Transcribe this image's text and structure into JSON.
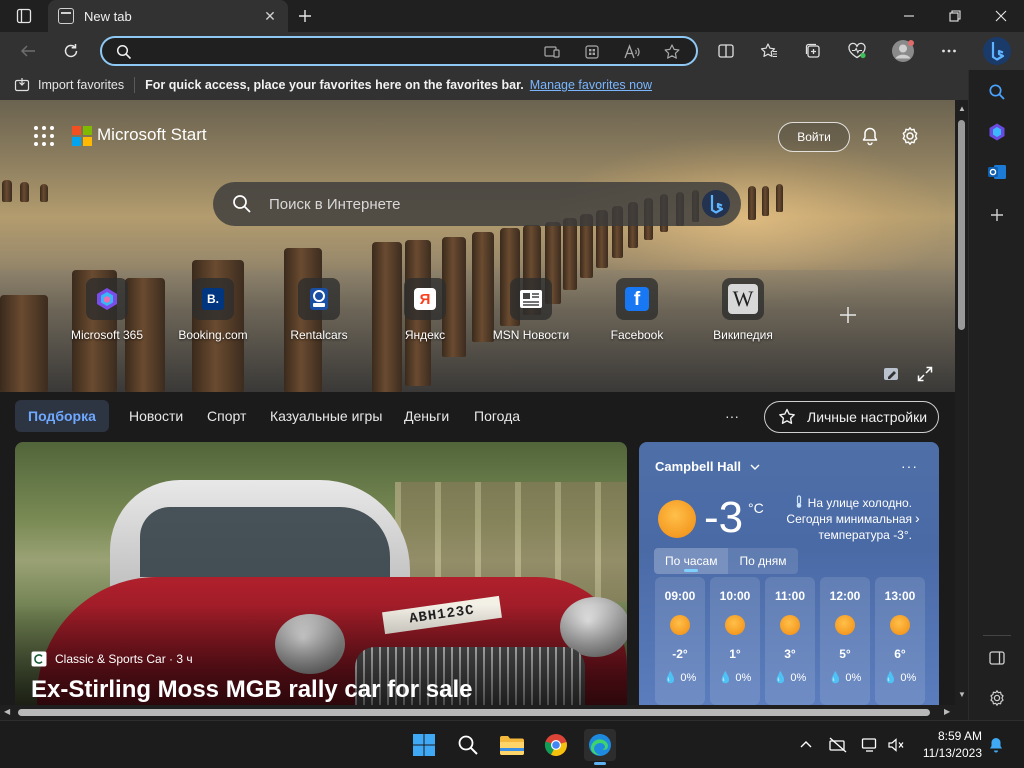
{
  "tab": {
    "title": "New tab"
  },
  "address": {
    "value": ""
  },
  "favorites_bar": {
    "import_label": "Import favorites",
    "message": "For quick access, place your favorites here on the favorites bar.",
    "link": "Manage favorites now"
  },
  "start": {
    "brand": "Microsoft Start",
    "signin": "Войти",
    "search_placeholder": "Поиск в Интернете"
  },
  "quick_links": [
    {
      "label": "Microsoft 365",
      "icon": "microsoft-365-icon"
    },
    {
      "label": "Booking.com",
      "icon": "booking-icon",
      "glyph": "B."
    },
    {
      "label": "Rentalcars",
      "icon": "rentalcars-icon"
    },
    {
      "label": "Яндекс",
      "icon": "yandex-icon",
      "glyph": "Я"
    },
    {
      "label": "MSN Новости",
      "icon": "msn-news-icon"
    },
    {
      "label": "Facebook",
      "icon": "facebook-icon",
      "glyph": "f"
    },
    {
      "label": "Википедия",
      "icon": "wikipedia-icon",
      "glyph": "W"
    }
  ],
  "feed_tabs": {
    "top": "Подборка",
    "news": "Новости",
    "sport": "Спорт",
    "casual_games": "Казуальные игры",
    "money": "Деньги",
    "weather": "Погода",
    "more": "···",
    "personalize": "Личные настройки"
  },
  "article": {
    "source": "Classic & Sports Car · 3 ч",
    "title": "Ex-Stirling Moss MGB rally car for sale",
    "plate": "ABH123C"
  },
  "weather": {
    "location": "Campbell Hall",
    "more": "···",
    "temp": "-3",
    "unit": "°C",
    "description": "На улице холодно. Сегодня минимальная температура -3°.",
    "tab_hourly": "По часам",
    "tab_daily": "По дням",
    "hours": [
      {
        "time": "09:00",
        "temp": "-2°",
        "precip": "0%"
      },
      {
        "time": "10:00",
        "temp": "1°",
        "precip": "0%"
      },
      {
        "time": "11:00",
        "temp": "3°",
        "precip": "0%"
      },
      {
        "time": "12:00",
        "temp": "5°",
        "precip": "0%"
      },
      {
        "time": "13:00",
        "temp": "6°",
        "precip": "0%"
      }
    ]
  },
  "taskbar": {
    "time": "8:59 AM",
    "date": "11/13/2023"
  },
  "colors": {
    "accent": "#8ec9f5",
    "link": "#7ab6ff",
    "active_tab_text": "#6ea8ff",
    "weather_card": "#4f6fa8"
  }
}
